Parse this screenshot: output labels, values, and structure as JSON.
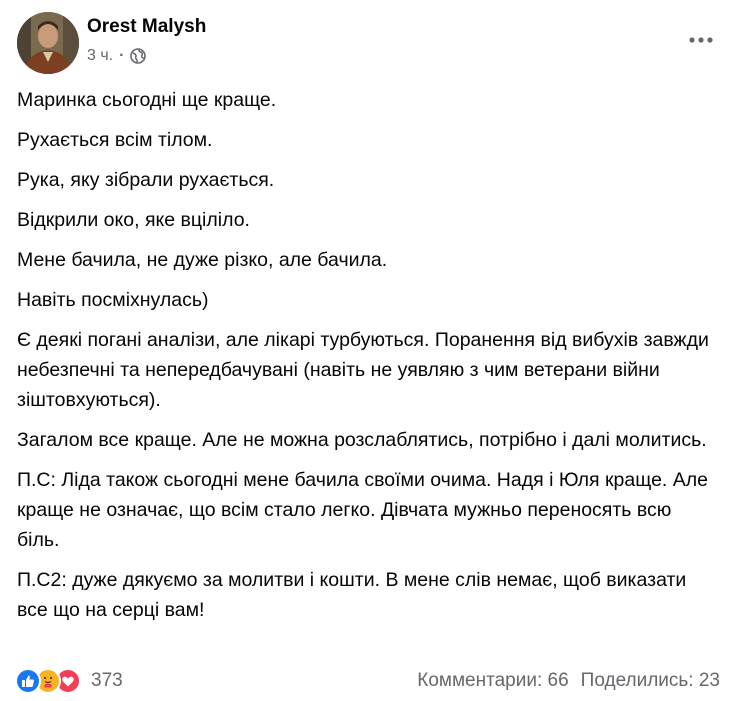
{
  "post": {
    "author": "Orest Malysh",
    "time": "3 ч.",
    "separator": "·",
    "privacy_icon": "globe-icon",
    "more_icon": "more-horizontal-icon",
    "paragraphs": [
      "Маринка сьогодні ще краще.",
      "Рухається всім тілом.",
      "Рука, яку зібрали рухається.",
      "Відкрили око, яке вціліло.",
      "Мене бачила, не дуже різко, але бачила.",
      "Навіть посміхнулась)",
      "Є деякі погані аналізи, але лікарі турбуються. Поранення від вибухів завжди небезпечні та непередбачувані (навіть не уявляю з чим ветерани війни зіштовхуються).",
      "Загалом все краще. Але не можна розслаблятись, потрібно і далі молитись.",
      "П.С: Ліда також сьогодні мене бачила своїми очима. Надя і Юля краще. Але краще не означає, що всім стало легко. Дівчата мужньо переносять всю біль.",
      "П.С2: дуже дякуємо за молитви і кошти. В мене слів немає, щоб виказати все що на серці вам!"
    ]
  },
  "footer": {
    "reaction_icons": [
      "like-icon",
      "care-icon",
      "love-icon"
    ],
    "reaction_count": "373",
    "comments": "Комментарии: 66",
    "shares": "Поделились: 23"
  },
  "colors": {
    "text": "#050505",
    "secondary": "#65676b",
    "like": "#1877f2",
    "love": "#f33e58",
    "care": "#f7b125"
  }
}
